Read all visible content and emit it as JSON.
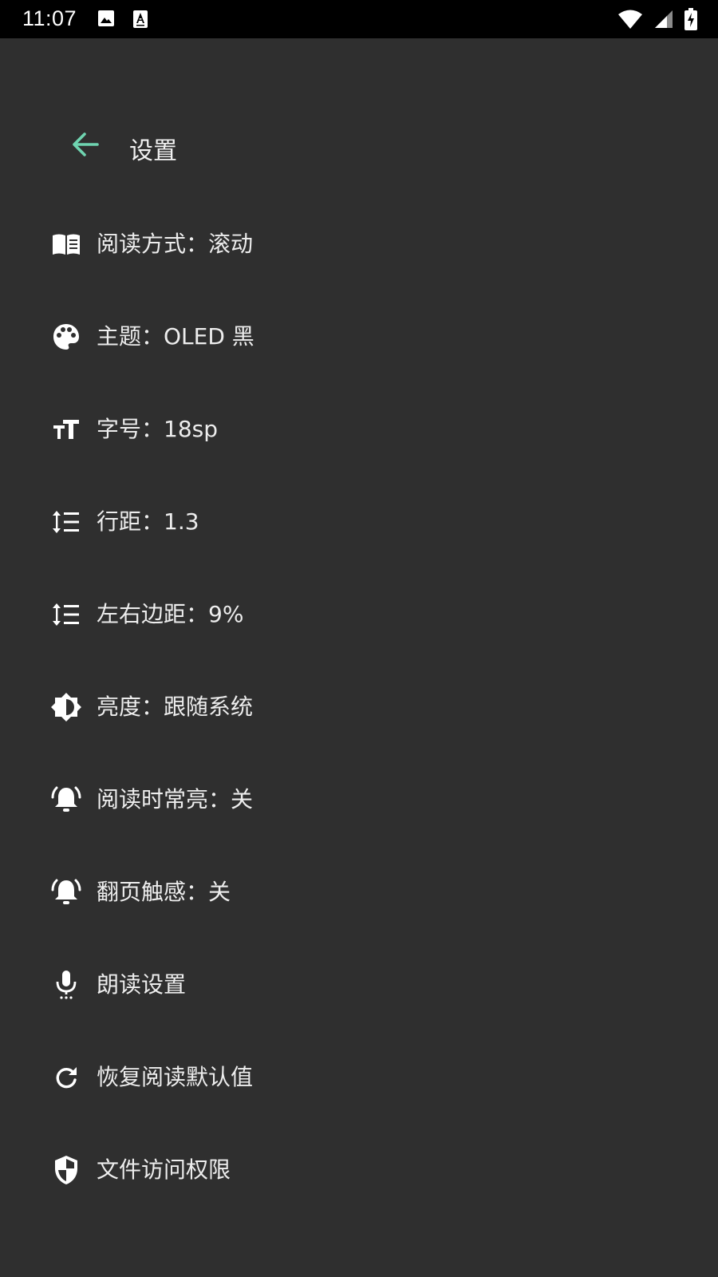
{
  "status_bar": {
    "time": "11:07",
    "icons": [
      "image-icon",
      "text-a-icon",
      "wifi-icon",
      "signal-icon",
      "battery-charging-icon"
    ]
  },
  "header": {
    "title": "设置",
    "back_icon": "arrow-left-icon"
  },
  "colors": {
    "background": "#2f2f2f",
    "status_bar": "#000000",
    "accent": "#6fd4b0",
    "text": "#ececec"
  },
  "settings": [
    {
      "icon": "book-icon",
      "label": "阅读方式：滚动"
    },
    {
      "icon": "palette-icon",
      "label": "主题：OLED 黑"
    },
    {
      "icon": "text-size-icon",
      "label": "字号：18sp"
    },
    {
      "icon": "line-spacing-icon",
      "label": "行距：1.3"
    },
    {
      "icon": "line-spacing-icon",
      "label": "左右边距：9%"
    },
    {
      "icon": "brightness-icon",
      "label": "亮度：跟随系统"
    },
    {
      "icon": "bell-ring-icon",
      "label": "阅读时常亮：关"
    },
    {
      "icon": "bell-ring-icon",
      "label": "翻页触感：关"
    },
    {
      "icon": "microphone-icon",
      "label": "朗读设置"
    },
    {
      "icon": "refresh-icon",
      "label": "恢复阅读默认值"
    },
    {
      "icon": "shield-icon",
      "label": "文件访问权限"
    }
  ]
}
